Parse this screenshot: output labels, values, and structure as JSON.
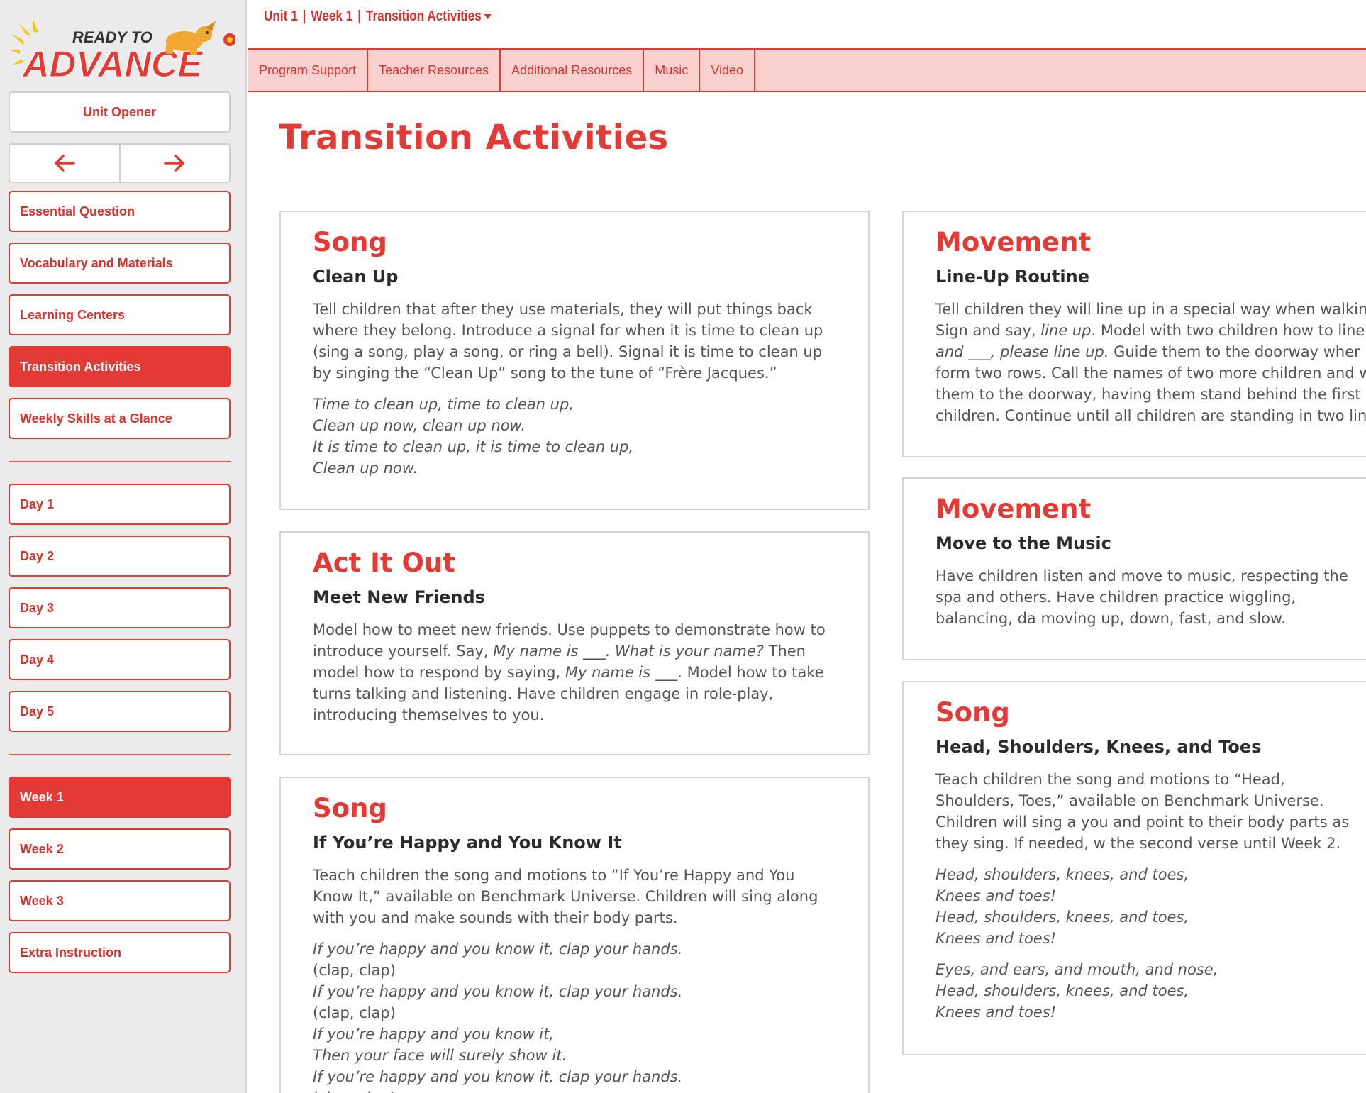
{
  "breadcrumb": {
    "unit": "Unit 1",
    "week": "Week 1",
    "activity": "Transition Activities",
    "separator": "|"
  },
  "logo": {
    "line1": "READY TO",
    "line2": "ADVANCE"
  },
  "sidebar": {
    "unit_opener": "Unit Opener",
    "top_items": [
      "Essential Question",
      "Vocabulary and Materials",
      "Learning Centers",
      "Transition Activities",
      "Weekly Skills at a Glance"
    ],
    "days": [
      "Day 1",
      "Day 2",
      "Day 3",
      "Day 4",
      "Day 5"
    ],
    "weeks": [
      "Week 1",
      "Week 2",
      "Week 3",
      "Extra Instruction"
    ],
    "active_top": "Transition Activities",
    "active_week": "Week 1"
  },
  "tabs": [
    "Program Support",
    "Teacher Resources",
    "Additional Resources",
    "Music",
    "Video"
  ],
  "page_title": "Transition Activities",
  "cards": {
    "song_clean_up": {
      "category": "Song",
      "title": "Clean Up",
      "body": "Tell children that after they use materials, they will put things back where they belong. Introduce a signal for when it is time to clean up (sing a song, play a song, or ring a bell). Signal it is time to clean up by singing the “Clean Up” song to the tune of “Frère Jacques.”",
      "verse": [
        "Time to clean up, time to clean up,",
        "Clean up now, clean up now.",
        "It is time to clean up, it is time to clean up,",
        "Clean up now."
      ]
    },
    "act_it_out": {
      "category": "Act It Out",
      "title": "Meet New Friends",
      "body_parts": [
        "Model how to meet new friends. Use puppets to demonstrate how to introduce yourself. Say, ",
        "My name is ___. What is your name?",
        " Then model how to respond by saying, ",
        "My name is ___",
        ". Model how to take turns talking and listening. Have children engage in role-play, introducing themselves to you."
      ]
    },
    "song_happy": {
      "category": "Song",
      "title": "If You’re Happy and You Know It",
      "body": "Teach children the song and motions to “If You’re Happy and You Know It,” available on Benchmark Universe. Children will sing along with you and make sounds with their body parts.",
      "verse": [
        "If you’re happy and you know it, clap your hands.",
        "(clap, clap)",
        "If you’re happy and you know it, clap your hands.",
        "(clap, clap)",
        "If you’re happy and you know it,",
        "Then your face will surely show it.",
        "If you’re happy and you know it, clap your hands.",
        "(clap, clap)"
      ]
    },
    "movement_line_up": {
      "category": "Movement",
      "title": "Line-Up Routine",
      "body_parts": [
        "Tell children they will line up in a special way when walking",
        "Sign and say, ",
        "line up",
        ". Model with two children how to line u",
        "and ___, please line up.",
        " Guide them to the doorway wher",
        "form two rows. Call the names of two more children and w",
        "them to the doorway, having them stand behind the first p",
        "children. Continue until all children are standing in two line"
      ]
    },
    "movement_music": {
      "category": "Movement",
      "title": "Move to the Music",
      "body": "Have children listen and move to music, respecting the spa and others. Have children practice wiggling, balancing, da moving up, down, fast, and slow."
    },
    "song_head": {
      "category": "Song",
      "title": "Head, Shoulders, Knees, and Toes",
      "body": "Teach children the song and motions to “Head, Shoulders, Toes,” available on Benchmark Universe. Children will sing a you and point to their body parts as they sing. If needed, w the second verse until Week 2.",
      "verse1": [
        "Head, shoulders, knees, and toes,",
        "Knees and toes!",
        "Head, shoulders, knees, and toes,",
        "Knees and toes!"
      ],
      "verse2": [
        "Eyes, and ears, and mouth, and nose,",
        "Head, shoulders, knees, and toes,",
        "Knees and toes!"
      ]
    }
  },
  "colors": {
    "accent": "#e43a35",
    "tab_bg": "#fbd1d0",
    "sidebar_bg": "#ebebeb"
  }
}
